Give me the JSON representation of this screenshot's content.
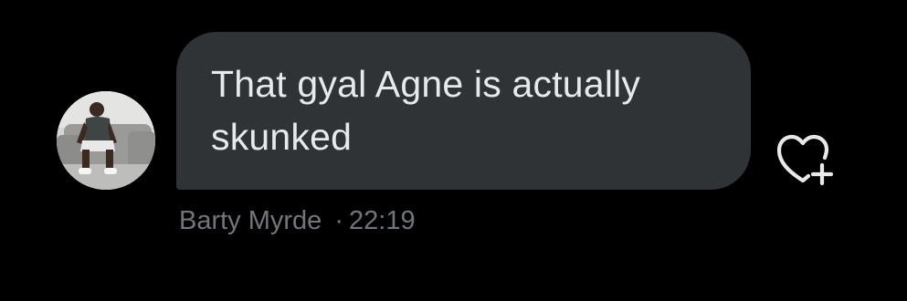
{
  "message": {
    "text": "That gyal Agne is actually skunked",
    "sender_name": "Barty Myrde",
    "separator": "·",
    "time": "22:19",
    "bubble_color": "#2f3336",
    "text_color": "#e7e9ea",
    "meta_color": "#71767b"
  },
  "actions": {
    "like_icon": "heart-plus-icon"
  }
}
